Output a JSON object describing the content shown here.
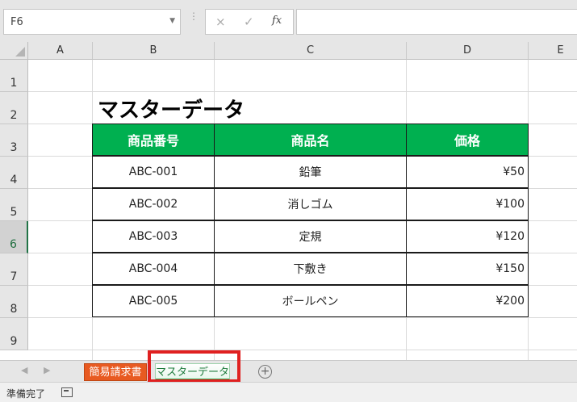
{
  "formula_bar": {
    "name_box": "F6",
    "cancel_icon": "×",
    "enter_icon": "✓",
    "fx_label": "fx",
    "formula": ""
  },
  "columns": [
    "A",
    "B",
    "C",
    "D",
    "E"
  ],
  "rows": [
    "1",
    "2",
    "3",
    "4",
    "5",
    "6",
    "7",
    "8",
    "9"
  ],
  "active_row": "6",
  "sheet": {
    "title": "マスターデータ",
    "table": {
      "headers": [
        "商品番号",
        "商品名",
        "価格"
      ],
      "rows": [
        [
          "ABC-001",
          "鉛筆",
          "¥50"
        ],
        [
          "ABC-002",
          "消しゴム",
          "¥100"
        ],
        [
          "ABC-003",
          "定規",
          "¥120"
        ],
        [
          "ABC-004",
          "下敷き",
          "¥150"
        ],
        [
          "ABC-005",
          "ボールペン",
          "¥200"
        ]
      ]
    }
  },
  "tabs": [
    {
      "label": "簡易請求書",
      "color": "#e85a21"
    },
    {
      "label": "マスターデータ",
      "color": "#2fa84f",
      "active": true
    }
  ],
  "add_sheet": "+",
  "status": {
    "text": "準備完了"
  },
  "colors": {
    "header_green": "#00b050",
    "highlight_red": "#e02020"
  }
}
